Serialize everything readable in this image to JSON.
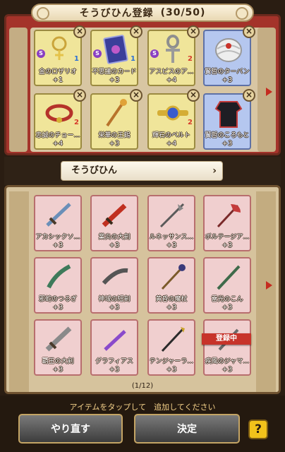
{
  "header": {
    "title": "そうびひん登録",
    "count": "(30/50)"
  },
  "registered": [
    {
      "name": "金のロザリオ",
      "plus": "+1",
      "tier": "gold",
      "icon": "rosary-icon",
      "badge_s": "S",
      "badge_n": "1",
      "badge_color": "blue"
    },
    {
      "name": "不思議のカード",
      "plus": "+3",
      "tier": "gold",
      "icon": "card-icon",
      "badge_s": "S",
      "badge_n": "1",
      "badge_color": "blue"
    },
    {
      "name": "アスピスのア…",
      "plus": "+4",
      "tier": "gold",
      "icon": "ankh-icon",
      "badge_s": "S",
      "badge_n": "2",
      "badge_color": "red"
    },
    {
      "name": "賢哲のターバン",
      "plus": "+3",
      "tier": "blue",
      "icon": "turban-icon",
      "badge_s": "",
      "badge_n": "",
      "badge_color": ""
    },
    {
      "name": "忠誠のチョー…",
      "plus": "+4",
      "tier": "gold",
      "icon": "choker-icon",
      "badge_s": "",
      "badge_n": "2",
      "badge_color": "red"
    },
    {
      "name": "栄華の王錫",
      "plus": "+3",
      "tier": "gold",
      "icon": "scepter-icon",
      "badge_s": "",
      "badge_n": "",
      "badge_color": ""
    },
    {
      "name": "輝石のベルト",
      "plus": "+4",
      "tier": "gold",
      "icon": "belt-icon",
      "badge_s": "",
      "badge_n": "2",
      "badge_color": "red"
    },
    {
      "name": "賢哲のころもと",
      "plus": "+3",
      "tier": "blue",
      "icon": "robe-icon",
      "badge_s": "",
      "badge_n": "",
      "badge_color": ""
    }
  ],
  "remove_label": "×",
  "filter": {
    "label": "そうびひん",
    "chevron": "›"
  },
  "inventory": [
    {
      "name": "アカシックソ…",
      "plus": "+3",
      "icon": "sword-icon"
    },
    {
      "name": "業炎の大剣",
      "plus": "+3",
      "icon": "flame-sword-icon"
    },
    {
      "name": "ルネッサンス…",
      "plus": "+3",
      "icon": "halberd-icon"
    },
    {
      "name": "ボルテージア…",
      "plus": "+3",
      "icon": "axe-icon"
    },
    {
      "name": "邪蛇のつるぎ",
      "plus": "+3",
      "icon": "serpent-sword-icon"
    },
    {
      "name": "神域の短剣",
      "plus": "+3",
      "icon": "dagger-icon"
    },
    {
      "name": "黄昏の魔杖",
      "plus": "+3",
      "icon": "staff-icon"
    },
    {
      "name": "雷光のこん",
      "plus": "+3",
      "icon": "rod-icon"
    },
    {
      "name": "覇王の大剣",
      "plus": "+3",
      "icon": "greatsword-icon"
    },
    {
      "name": "グラフィアス",
      "plus": "+3",
      "icon": "purple-dagger-icon"
    },
    {
      "name": "テンジャーラ…",
      "plus": "+3",
      "icon": "spear-icon"
    },
    {
      "name": "疾風のジャマ…",
      "plus": "+3",
      "icon": "jamadhar-icon"
    }
  ],
  "registered_tag": "登録中",
  "page": "(1/12)",
  "hint": "アイテムをタップして　追加してください",
  "buttons": {
    "redo": "やり直す",
    "confirm": "決定",
    "help": "?"
  }
}
